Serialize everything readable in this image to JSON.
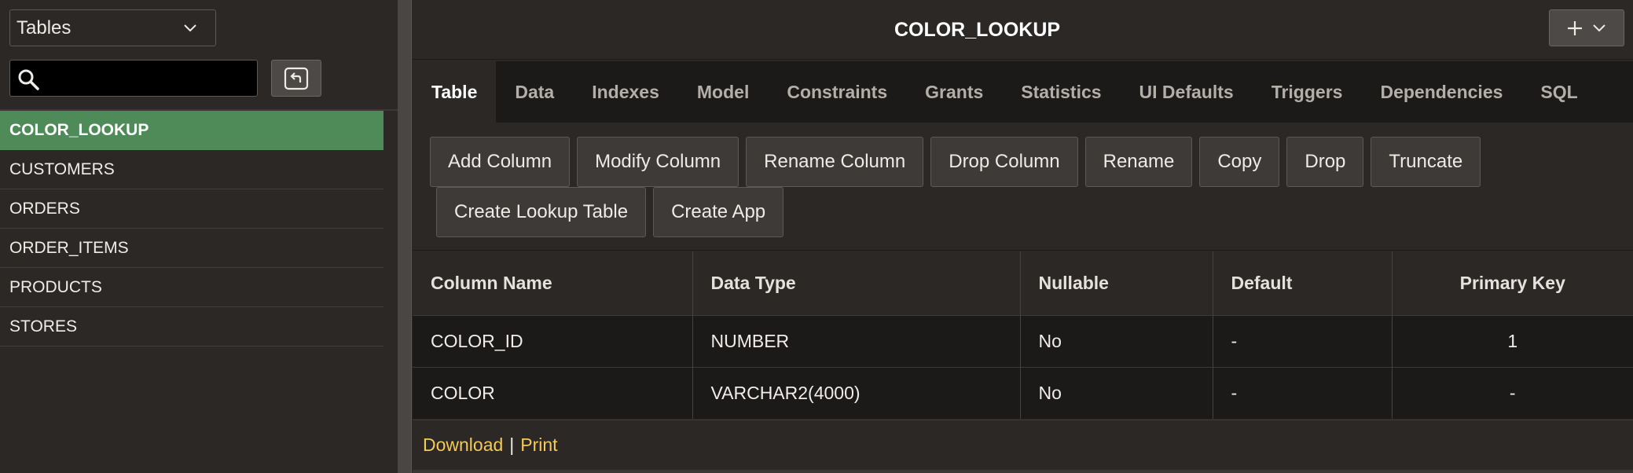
{
  "object_type_select": {
    "value": "Tables"
  },
  "search": {
    "value": "",
    "placeholder": ""
  },
  "tables": [
    "COLOR_LOOKUP",
    "CUSTOMERS",
    "ORDERS",
    "ORDER_ITEMS",
    "PRODUCTS",
    "STORES"
  ],
  "selected_table": "COLOR_LOOKUP",
  "header": {
    "title": "COLOR_LOOKUP"
  },
  "tabs": [
    "Table",
    "Data",
    "Indexes",
    "Model",
    "Constraints",
    "Grants",
    "Statistics",
    "UI Defaults",
    "Triggers",
    "Dependencies",
    "SQL"
  ],
  "active_tab": "Table",
  "toolbar": {
    "row1": [
      "Add Column",
      "Modify Column",
      "Rename Column",
      "Drop Column",
      "Rename",
      "Copy",
      "Drop",
      "Truncate"
    ],
    "row2": [
      "Create Lookup Table",
      "Create App"
    ]
  },
  "columns_table": {
    "headers": [
      "Column Name",
      "Data Type",
      "Nullable",
      "Default",
      "Primary Key"
    ],
    "rows": [
      [
        "COLOR_ID",
        "NUMBER",
        "No",
        "-",
        "1"
      ],
      [
        "COLOR",
        "VARCHAR2(4000)",
        "No",
        "-",
        "-"
      ]
    ]
  },
  "footer": {
    "download": "Download",
    "separator": "|",
    "print": "Print"
  },
  "colors": {
    "selected_bg": "#4f8a59",
    "link": "#f4c95a",
    "background": "#2b2826",
    "dark_band": "#1c1a19"
  }
}
